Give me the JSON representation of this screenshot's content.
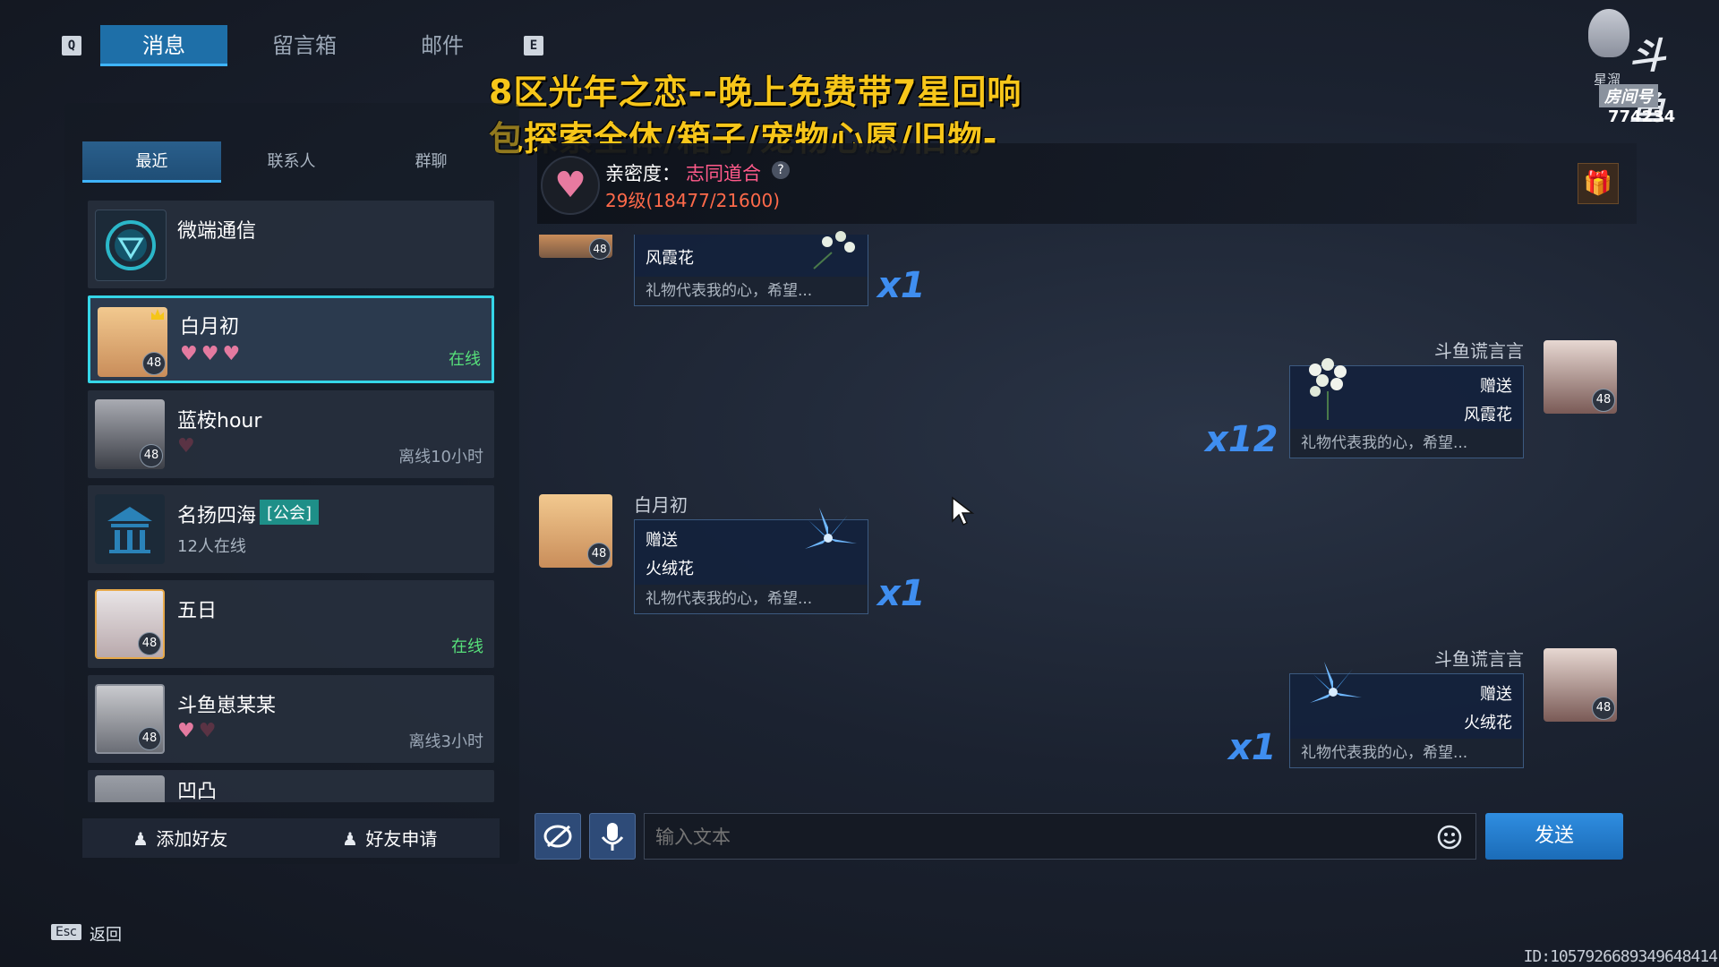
{
  "keys": {
    "prev": "Q",
    "next": "E",
    "esc": "Esc"
  },
  "top_tabs": [
    "消息",
    "留言箱",
    "邮件"
  ],
  "overlay": {
    "line1": "8区光年之恋--晚上免费带7星回响",
    "line2": "包探索全体/箱子/宠物心愿/旧物-"
  },
  "room": {
    "logo": "斗鱼",
    "label": "星溜",
    "room_label": "房间号",
    "room_number": "774234"
  },
  "sub_tabs": [
    "最近",
    "联系人",
    "群聊"
  ],
  "contacts": [
    {
      "name": "微端通信",
      "status": "",
      "level": ""
    },
    {
      "name": "白月初",
      "status": "在线",
      "level": "48"
    },
    {
      "name": "蓝桉hour",
      "status": "离线10小时",
      "level": "48"
    },
    {
      "name": "名扬四海",
      "tag": "[公会]",
      "subtitle": "12人在线",
      "level": ""
    },
    {
      "name": "五日",
      "status": "在线",
      "level": "48"
    },
    {
      "name": "斗鱼崽某某",
      "status": "离线3小时",
      "level": "48"
    },
    {
      "name": "凹凸",
      "status": "",
      "level": ""
    }
  ],
  "buttons": {
    "add_friend": "添加好友",
    "friend_request": "好友申请",
    "back": "返回",
    "send": "发送"
  },
  "intimacy": {
    "label": "亲密度：",
    "value": "志同道合",
    "help": "?",
    "level_text": "29级(18477/21600)"
  },
  "chat": {
    "messages": [
      {
        "sender": "",
        "action": "",
        "gift": "风霞花",
        "note": "礼物代表我的心，希望...",
        "count": "x1",
        "level": "48"
      },
      {
        "sender": "斗鱼谎言言",
        "action": "赠送",
        "gift": "风霞花",
        "note": "礼物代表我的心，希望...",
        "count": "x12",
        "level": "48"
      },
      {
        "sender": "白月初",
        "action": "赠送",
        "gift": "火绒花",
        "note": "礼物代表我的心，希望...",
        "count": "x1",
        "level": "48"
      },
      {
        "sender": "斗鱼谎言言",
        "action": "赠送",
        "gift": "火绒花",
        "note": "礼物代表我的心，希望...",
        "count": "x1",
        "level": "48"
      }
    ]
  },
  "input": {
    "placeholder": "输入文本"
  },
  "footer_id": "ID:1057926689349648414",
  "colors": {
    "accent": "#3fb4ff",
    "online": "#57e07a",
    "overlay_text": "#f7c61a",
    "intimacy_value": "#ff5a8a",
    "gift_count": "#3f8ef0"
  }
}
